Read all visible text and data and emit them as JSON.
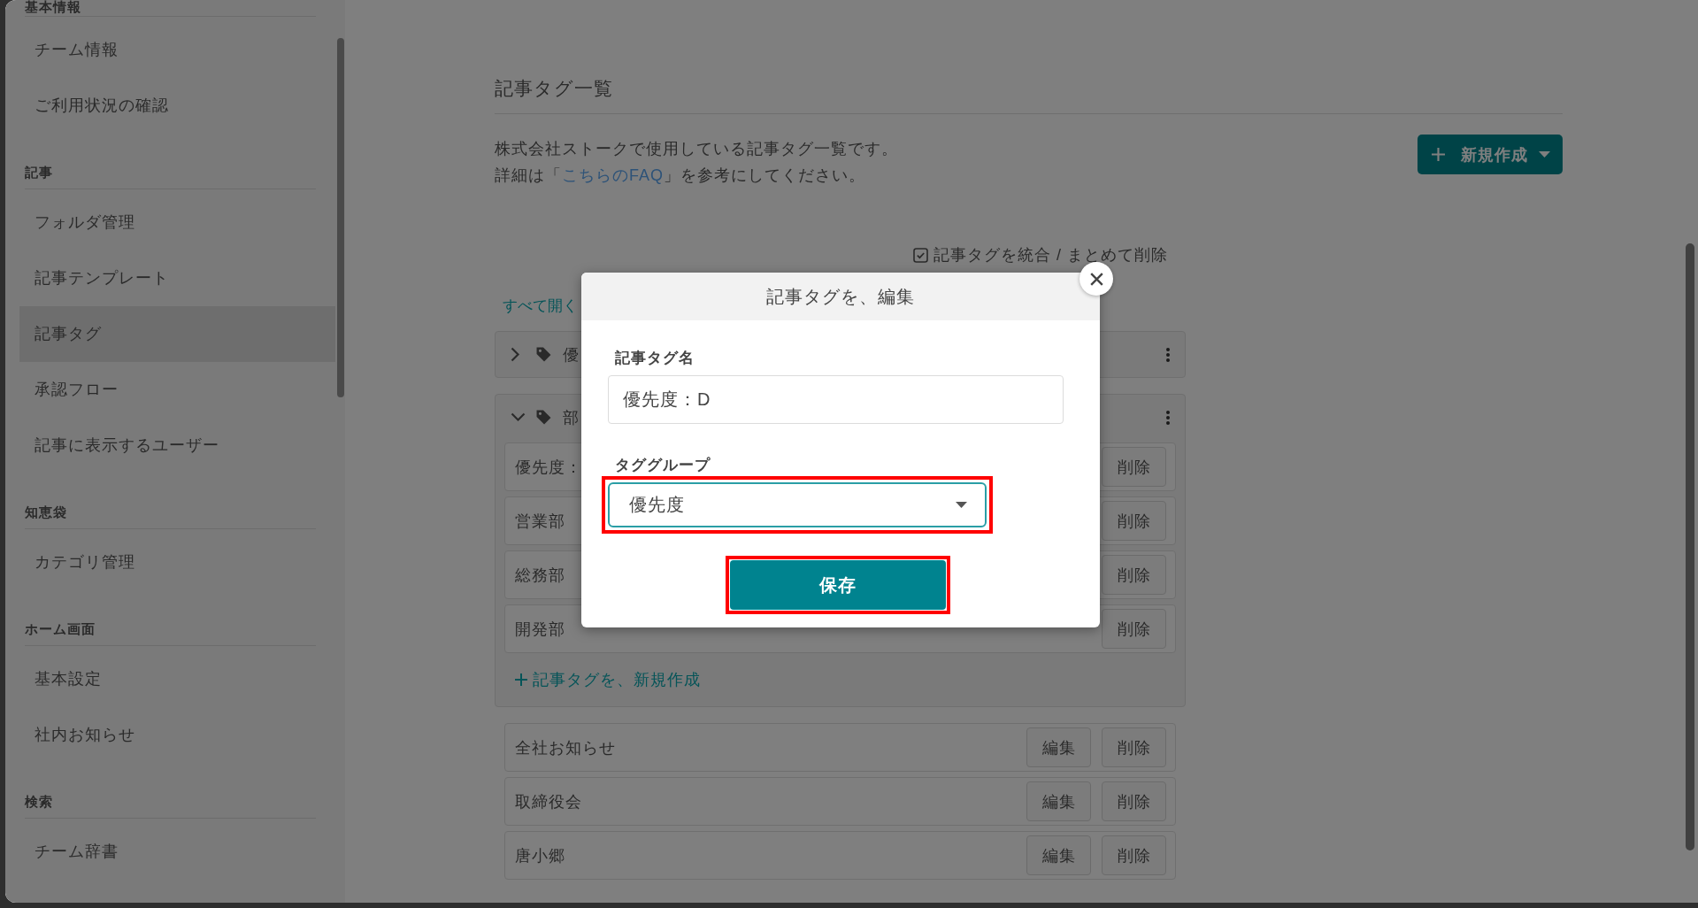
{
  "sidebar": {
    "sections": [
      {
        "heading": "基本情報",
        "items": [
          {
            "label": "チーム情報",
            "selected": false
          },
          {
            "label": "ご利用状況の確認",
            "selected": false
          }
        ]
      },
      {
        "heading": "記事",
        "items": [
          {
            "label": "フォルダ管理",
            "selected": false
          },
          {
            "label": "記事テンプレート",
            "selected": false
          },
          {
            "label": "記事タグ",
            "selected": true
          },
          {
            "label": "承認フロー",
            "selected": false
          },
          {
            "label": "記事に表示するユーザー",
            "selected": false
          }
        ]
      },
      {
        "heading": "知恵袋",
        "items": [
          {
            "label": "カテゴリ管理",
            "selected": false
          }
        ]
      },
      {
        "heading": "ホーム画面",
        "items": [
          {
            "label": "基本設定",
            "selected": false
          },
          {
            "label": "社内お知らせ",
            "selected": false
          }
        ]
      },
      {
        "heading": "検索",
        "items": [
          {
            "label": "チーム辞書",
            "selected": false
          }
        ]
      }
    ]
  },
  "page": {
    "title": "記事タグ一覧",
    "description": [
      {
        "text": "株式会社ストークで使用している記事タグ一覧です。"
      },
      {
        "text": "詳細は「",
        "link": "こちらのFAQ",
        "text_after": "」を参考にしてください。"
      }
    ],
    "new_button": {
      "label": "新規作成"
    },
    "merge_toggle": {
      "label": "記事タグを統合 / まとめて削除"
    },
    "expand_all_link": "すべて開く",
    "groups": [
      {
        "name": "優",
        "expanded": false
      },
      {
        "name": "部",
        "expanded": true,
        "tags": [
          {
            "name": "優先度：",
            "delete": "削除"
          },
          {
            "name": "営業部",
            "delete": "削除"
          },
          {
            "name": "総務部",
            "delete": "削除"
          },
          {
            "name": "開発部",
            "delete": "削除"
          }
        ],
        "add_link": "記事タグを、新規作成"
      }
    ],
    "ungrouped_tags": [
      {
        "name": "全社お知らせ",
        "edit": "編集",
        "delete": "削除"
      },
      {
        "name": "取締役会",
        "edit": "編集",
        "delete": "削除"
      },
      {
        "name": "唐小郷",
        "edit": "編集",
        "delete": "削除"
      }
    ]
  },
  "dialog": {
    "title": "記事タグを、編集",
    "fields": [
      {
        "kind": "text",
        "label": "記事タグ名",
        "value": "優先度：D",
        "highlighted": false
      },
      {
        "kind": "select",
        "label": "タググループ",
        "value": "優先度",
        "highlighted": true
      }
    ],
    "save_button": {
      "label": "保存",
      "highlighted": true
    }
  }
}
